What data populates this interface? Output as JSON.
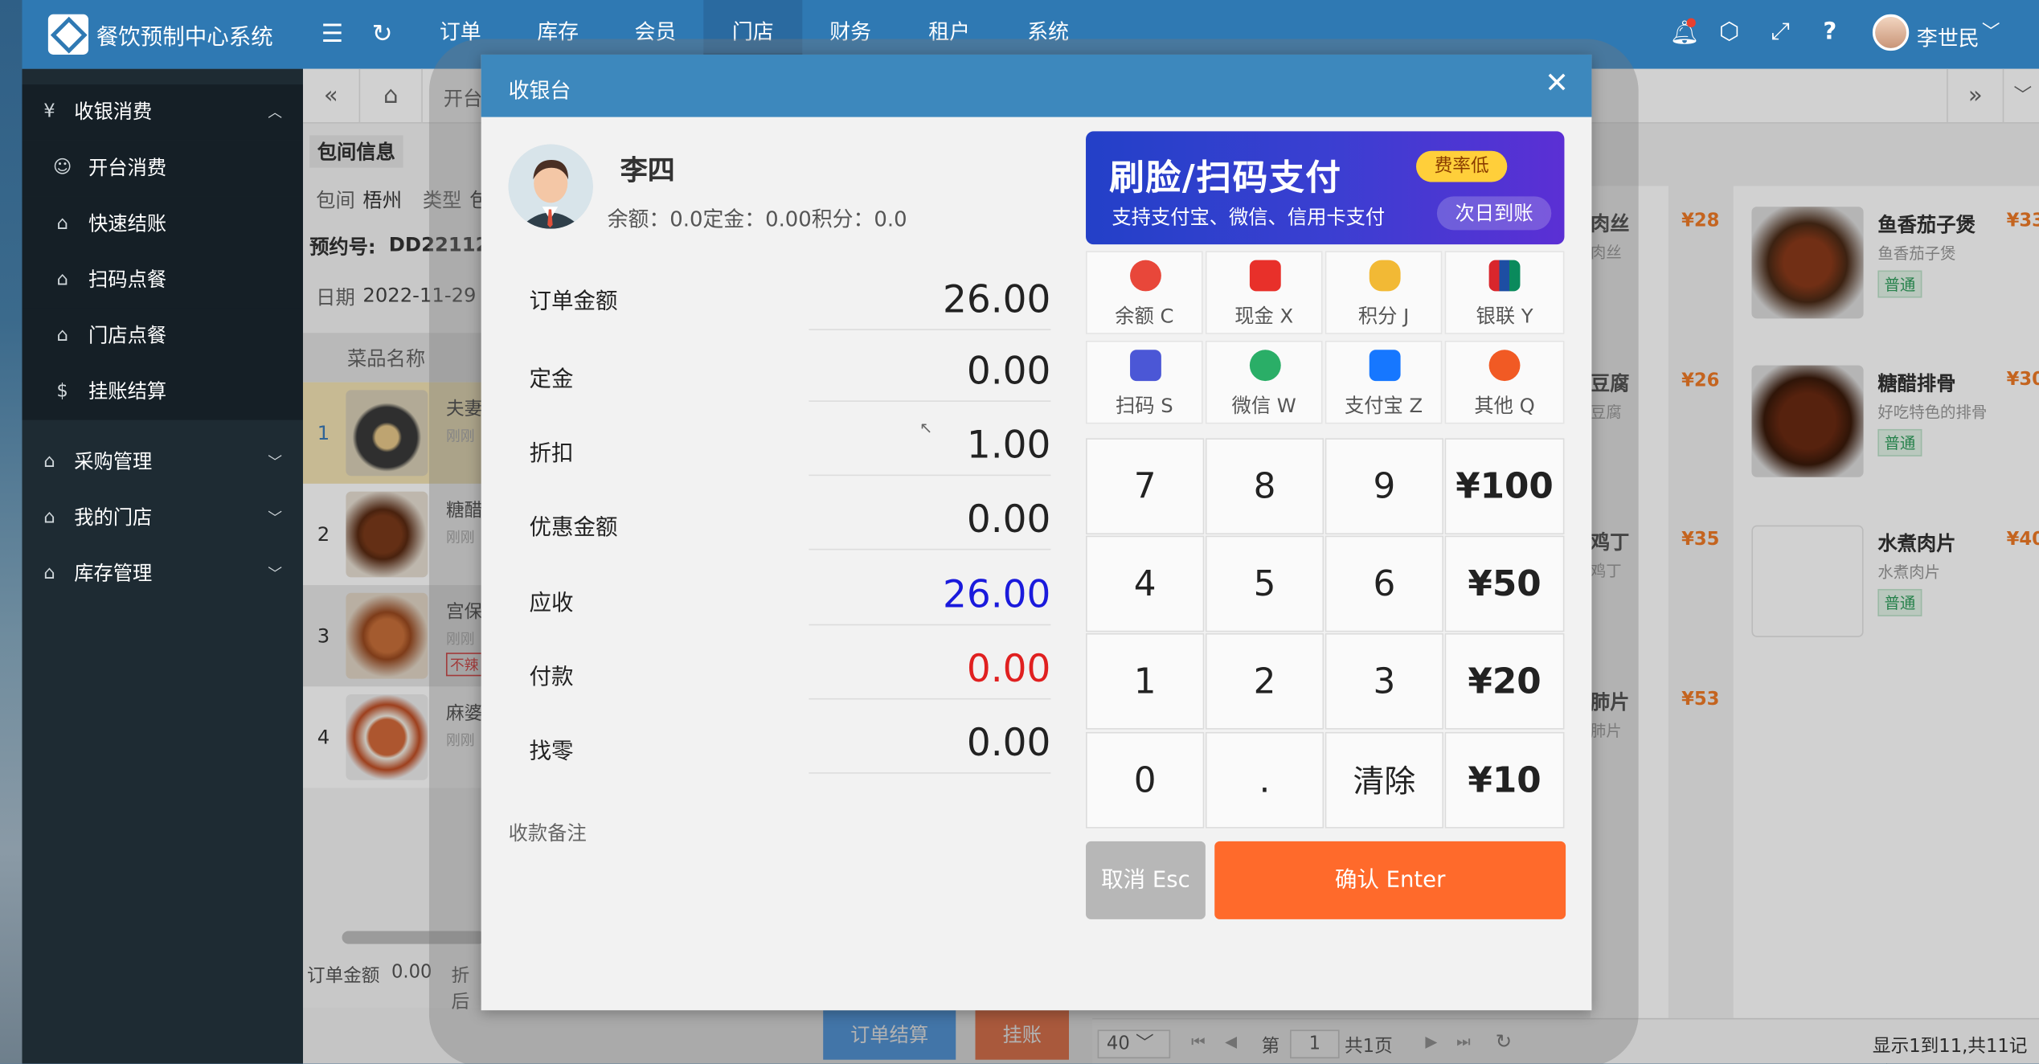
{
  "app": {
    "brand": "餐饮预制中心系统"
  },
  "topnav": {
    "items": [
      "订单",
      "库存",
      "会员",
      "门店",
      "财务",
      "租户",
      "系统"
    ],
    "active": "门店"
  },
  "user": {
    "name": "李世民"
  },
  "sidebar": {
    "group1": {
      "label": "收银消费",
      "items": [
        "开台消费",
        "快速结账",
        "扫码点餐",
        "门店点餐",
        "挂账结算"
      ]
    },
    "group2": "采购管理",
    "group3": "我的门店",
    "group4": "库存管理"
  },
  "tabs": {
    "open_table": "开台"
  },
  "order_panel": {
    "section_title": "包间信息",
    "room_label": "包间",
    "room_value": "梧州",
    "type_label": "类型",
    "type_value": "包",
    "reservation_label": "预约号:",
    "reservation_value": "DD221129",
    "date_label": "日期",
    "date_value": "2022-11-29",
    "col_dish": "菜品名称",
    "rows": [
      {
        "no": "1",
        "name": "夫妻",
        "status": "刚刚"
      },
      {
        "no": "2",
        "name": "糖醋",
        "status": "刚刚"
      },
      {
        "no": "3",
        "name": "宫保",
        "status": "刚刚",
        "tag": "不辣"
      },
      {
        "no": "4",
        "name": "麻婆",
        "status": "刚刚"
      }
    ],
    "total_label": "订单金额",
    "total_value": "0.00",
    "discount_label": "折后"
  },
  "bottom": {
    "settle_btn": "订单结算",
    "credit_btn": "挂账",
    "page_size": "40",
    "page_prefix": "第",
    "page_no": "1",
    "page_total": "共1页",
    "records": "显示1到11,共11记录"
  },
  "dishes": [
    {
      "name": "肉丝",
      "desc": "肉丝",
      "price": "¥28"
    },
    {
      "name": "豆腐",
      "desc": "豆腐",
      "price": "¥26"
    },
    {
      "name": "鸡丁",
      "desc": "鸡丁",
      "price": "¥35"
    },
    {
      "name": "肺片",
      "desc": "肺片",
      "price": "¥53"
    },
    {
      "name": "鱼香茄子煲",
      "desc": "鱼香茄子煲",
      "price": "¥33",
      "tag": "普通"
    },
    {
      "name": "糖醋排骨",
      "desc": "好吃特色的排骨",
      "price": "¥30",
      "tag": "普通"
    },
    {
      "name": "水煮肉片",
      "desc": "水煮肉片",
      "price": "¥40",
      "tag": "普通"
    }
  ],
  "modal": {
    "title": "收银台",
    "customer": {
      "name": "李四",
      "info": "余额：0.0定金：0.00积分：0.0"
    },
    "fields": [
      {
        "label": "订单金额",
        "value": "26.00",
        "color": "#222222"
      },
      {
        "label": "定金",
        "value": "0.00",
        "color": "#222222"
      },
      {
        "label": "折扣",
        "value": "1.00",
        "color": "#222222"
      },
      {
        "label": "优惠金额",
        "value": "0.00",
        "color": "#222222"
      },
      {
        "label": "应收",
        "value": "26.00",
        "color": "#1a1adc"
      },
      {
        "label": "付款",
        "value": "0.00",
        "color": "#e02020"
      },
      {
        "label": "找零",
        "value": "0.00",
        "color": "#222222"
      }
    ],
    "remark_label": "收款备注",
    "banner": {
      "main": "刷脸/扫码支付",
      "sub": "支持支付宝、微信、信用卡支付",
      "tag1": "费率低",
      "tag2": "次日到账"
    },
    "pay_methods": [
      {
        "label": "余额 C",
        "icon": "money-bag-icon",
        "color": "#e8473a"
      },
      {
        "label": "现金 X",
        "icon": "wallet-icon",
        "color": "#e8302a"
      },
      {
        "label": "积分 J",
        "icon": "coins-icon",
        "color": "#f2b935"
      },
      {
        "label": "银联 Y",
        "icon": "unionpay-icon",
        "color": "#1d4ea3"
      },
      {
        "label": "扫码 S",
        "icon": "scan-icon",
        "color": "#4b57d6"
      },
      {
        "label": "微信 W",
        "icon": "wechat-icon",
        "color": "#2aae67"
      },
      {
        "label": "支付宝 Z",
        "icon": "alipay-icon",
        "color": "#1677ff"
      },
      {
        "label": "其他 Q",
        "icon": "more-icon",
        "color": "#f15a24"
      }
    ],
    "keypad": [
      "7",
      "8",
      "9",
      "¥100",
      "4",
      "5",
      "6",
      "¥50",
      "1",
      "2",
      "3",
      "¥20",
      "0",
      ".",
      "清除",
      "¥10"
    ],
    "cancel_btn": "取消 Esc",
    "confirm_btn": "确认 Enter"
  }
}
